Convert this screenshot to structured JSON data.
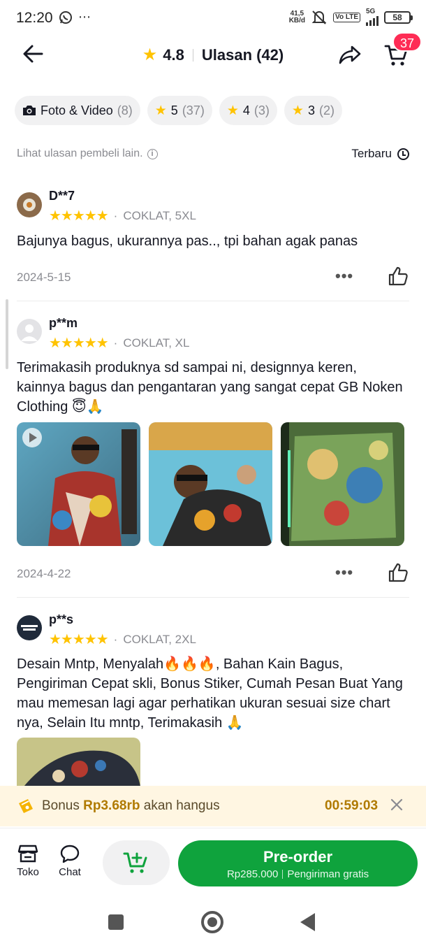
{
  "status_bar": {
    "time": "12:20",
    "notif_glyph": "⋯",
    "net_speed_value": "41,5",
    "net_speed_unit": "KB/d",
    "volte_label": "Vo LTE",
    "network": "5G",
    "battery": "58"
  },
  "header": {
    "rating": "4.8",
    "title": "Ulasan (42)",
    "cart_count": "37"
  },
  "filters": [
    {
      "label": "Foto & Video",
      "count": "(8)",
      "icon": "camera-icon"
    },
    {
      "label": "5",
      "count": "(37)",
      "icon": "star-icon"
    },
    {
      "label": "4",
      "count": "(3)",
      "icon": "star-icon"
    },
    {
      "label": "3",
      "count": "(2)",
      "icon": "star-icon"
    }
  ],
  "hint": {
    "text": "Lihat ulasan pembeli lain.",
    "sort_label": "Terbaru"
  },
  "reviews": [
    {
      "name": "D**7",
      "stars": "★★★★★",
      "variant": "COKLAT, 5XL",
      "text": "Bajunya bagus, ukurannya pas.., tpi bahan agak panas",
      "date": "2024-5-15"
    },
    {
      "name": "p**m",
      "stars": "★★★★★",
      "variant": "COKLAT, XL",
      "text": "Terimakasih produknya sd sampai ni, designnya keren, kainnya bagus dan pengantaran yang sangat cepat GB Noken Clothing 😇🙏",
      "date": "2024-4-22"
    },
    {
      "name": "p**s",
      "stars": "★★★★★",
      "variant": "COKLAT, 2XL",
      "text": "Desain Mntp, Menyalah🔥🔥🔥, Bahan Kain Bagus, Pengiriman Cepat skli, Bonus Stiker, Cumah Pesan Buat Yang mau memesan lagi agar perhatikan ukuran sesuai size chart nya, Selain Itu mntp, Terimakasih 🙏"
    }
  ],
  "meta_sep": "·",
  "bonus": {
    "prefix": "Bonus",
    "amount": "Rp3.68rb",
    "suffix": "akan hangus",
    "timer": "00:59:03"
  },
  "bottom_bar": {
    "shop_label": "Toko",
    "chat_label": "Chat",
    "cta_title": "Pre-order",
    "cta_price": "Rp285.000",
    "cta_shipping": "Pengiriman gratis"
  },
  "colors": {
    "accent_green": "#0FA33D",
    "star": "#FFC300",
    "badge": "#FE2C55",
    "bonus_bg": "#FFF6E2"
  }
}
